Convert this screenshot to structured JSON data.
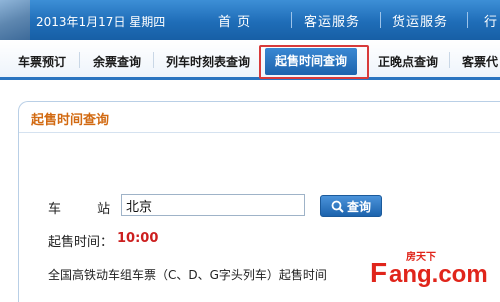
{
  "header": {
    "date": "2013年1月17日 星期四",
    "nav": [
      "首 页",
      "客运服务",
      "货运服务",
      "行"
    ]
  },
  "tabs": [
    {
      "label": "车票预订",
      "active": false
    },
    {
      "label": "余票查询",
      "active": false
    },
    {
      "label": "列车时刻表查询",
      "active": false
    },
    {
      "label": "起售时间查询",
      "active": true
    },
    {
      "label": "正晚点查询",
      "active": false
    },
    {
      "label": "客票代",
      "active": false
    }
  ],
  "panel": {
    "title": "起售时间查询",
    "station_label": "车 站",
    "station_colon": "：",
    "station_value": "北京",
    "search_button": "查询",
    "time_label": "起售时间：",
    "time_value": "10:00",
    "notice": "全国高铁动车组车票（C、D、G字头列车）起售时间"
  },
  "watermark": {
    "logo_text": "Fang.com",
    "logo_cn": "房天下"
  },
  "colors": {
    "header_blue": "#1f6db8",
    "active_tab": "#1c63ad",
    "highlight_border": "#d83a3a",
    "panel_title": "#d26a12",
    "time_value": "#cc1f1f",
    "watermark_red": "#e0251b"
  },
  "icons": {
    "search_button_icon": "magnifier-icon"
  }
}
